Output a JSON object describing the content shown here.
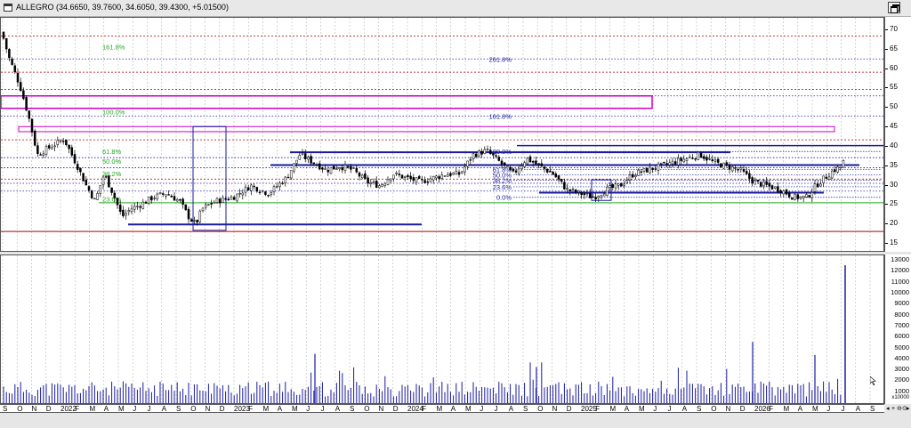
{
  "window": {
    "title": "ALLEGRO (34.6650, 39.7600, 34.6050, 39.4300, +5.01500)"
  },
  "price_axis": {
    "labels": [
      "70",
      "65",
      "60",
      "55",
      "50",
      "45",
      "40",
      "35",
      "30",
      "25",
      "20",
      "15"
    ],
    "min": 13.2,
    "max": 73.2
  },
  "volume_axis": {
    "labels": [
      "13000",
      "12000",
      "11000",
      "10000",
      "9000",
      "8000",
      "7000",
      "6000",
      "5000",
      "4000",
      "3000",
      "2000",
      "1000"
    ],
    "scale_label": "x10000",
    "max": 13500
  },
  "time_axis": {
    "labels": [
      "S",
      "O",
      "N",
      "D",
      "2022",
      "F",
      "M",
      "A",
      "M",
      "J",
      "J",
      "A",
      "S",
      "O",
      "N",
      "D",
      "2023",
      "F",
      "M",
      "A",
      "M",
      "J",
      "J",
      "A",
      "S",
      "O",
      "N",
      "D",
      "2024",
      "F",
      "M",
      "A",
      "M",
      "J",
      "J",
      "A",
      "S",
      "O",
      "N",
      "D",
      "2025",
      "F",
      "M",
      "A",
      "M",
      "J",
      "J",
      "A",
      "S",
      "O",
      "N",
      "D",
      "2026",
      "F",
      "M",
      "A",
      "M",
      "J",
      "J",
      "A",
      "S"
    ]
  },
  "fibonacci_left": {
    "labels": [
      "161.8%",
      "100.0%",
      "61.8%",
      "50.0%",
      "38.2%",
      "23.6%"
    ],
    "levels": [
      65.8,
      49.0,
      38.8,
      36.3,
      33.1,
      26.6
    ],
    "color": "#22aa22"
  },
  "fibonacci_upper": {
    "labels": [
      "261.8%",
      "161.8%"
    ],
    "levels": [
      62.6,
      47.9
    ],
    "color": "#1a1aa0"
  },
  "fibonacci_right": {
    "labels": [
      "100.0%",
      "61.8%",
      "50.0%",
      "38.2%",
      "23.6%",
      "0.0%"
    ],
    "levels": [
      38.8,
      34.2,
      32.8,
      31.4,
      29.7,
      27.0
    ],
    "color": "#1a1aa0"
  },
  "horizontal_lines": {
    "red_dotted": [
      68.5,
      59.2,
      54.8,
      41.8,
      31.7
    ],
    "red_solid": 18.2,
    "blue_dotted": [
      62.6,
      53.1,
      47.9,
      37.2,
      34.6,
      30.6,
      28.6
    ],
    "green_solid": 25.6
  },
  "colors": {
    "candle_up": "#ffffff",
    "candle_down": "#000000",
    "volume_bar": "#1a1aa0",
    "support_band": "#1a1aa0",
    "resistance_box": "#cc00cc",
    "red_line": "#b00000",
    "grid": "#b8b8b8"
  },
  "chart_data": {
    "type": "candlestick",
    "x_range": [
      "2021-09",
      "2026-09"
    ],
    "ylim": [
      13.2,
      73.2
    ],
    "approx_close_path": [
      [
        0,
        69.5
      ],
      [
        8,
        63
      ],
      [
        20,
        56
      ],
      [
        30,
        48
      ],
      [
        40,
        38
      ],
      [
        55,
        40
      ],
      [
        70,
        42
      ],
      [
        85,
        35
      ],
      [
        95,
        30
      ],
      [
        105,
        26
      ],
      [
        115,
        33
      ],
      [
        125,
        28
      ],
      [
        135,
        22
      ],
      [
        145,
        24
      ],
      [
        155,
        25
      ],
      [
        170,
        27
      ],
      [
        185,
        28
      ],
      [
        200,
        26
      ],
      [
        210,
        22
      ],
      [
        218,
        20
      ],
      [
        225,
        24
      ],
      [
        240,
        26
      ],
      [
        260,
        27
      ],
      [
        280,
        30
      ],
      [
        300,
        28
      ],
      [
        320,
        32
      ],
      [
        335,
        38
      ],
      [
        350,
        36
      ],
      [
        365,
        34
      ],
      [
        380,
        35
      ],
      [
        395,
        34
      ],
      [
        410,
        31
      ],
      [
        425,
        30
      ],
      [
        440,
        33
      ],
      [
        455,
        32
      ],
      [
        470,
        31
      ],
      [
        485,
        32
      ],
      [
        500,
        33
      ],
      [
        515,
        33
      ],
      [
        530,
        38
      ],
      [
        545,
        39
      ],
      [
        560,
        36
      ],
      [
        575,
        33
      ],
      [
        590,
        37
      ],
      [
        605,
        35
      ],
      [
        620,
        33
      ],
      [
        635,
        29
      ],
      [
        650,
        28
      ],
      [
        665,
        27
      ],
      [
        680,
        29
      ],
      [
        695,
        30
      ],
      [
        710,
        33
      ],
      [
        725,
        34
      ],
      [
        740,
        35
      ],
      [
        755,
        36
      ],
      [
        770,
        37
      ],
      [
        785,
        38
      ],
      [
        800,
        36
      ],
      [
        815,
        35
      ],
      [
        830,
        34
      ],
      [
        845,
        31
      ],
      [
        860,
        30
      ],
      [
        875,
        29
      ],
      [
        890,
        27
      ],
      [
        905,
        27
      ],
      [
        915,
        30
      ],
      [
        925,
        32
      ],
      [
        935,
        34
      ],
      [
        945,
        35
      ],
      [
        949,
        39.4
      ]
    ]
  }
}
